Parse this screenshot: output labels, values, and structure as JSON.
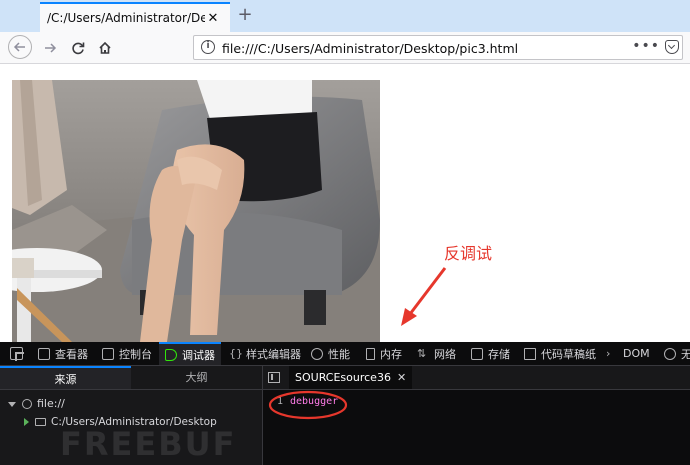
{
  "browser": {
    "tab": {
      "title": "/C:/Users/Administrator/Desktop",
      "close_glyph": "✕"
    },
    "new_tab_glyph": "+",
    "url": "file:///C:/Users/Administrator/Desktop/pic3.html",
    "more_glyph": "•••",
    "accent_color": "#0a84ff"
  },
  "annotation": {
    "label": "反调试",
    "color": "#e6372c"
  },
  "devtools": {
    "tabs": [
      {
        "label": "查看器",
        "icon": "inspector-icon"
      },
      {
        "label": "控制台",
        "icon": "console-icon"
      },
      {
        "label": "调试器",
        "icon": "debugger-icon",
        "active": true
      },
      {
        "label": "样式编辑器",
        "icon": "style-editor-icon"
      },
      {
        "label": "性能",
        "icon": "performance-icon"
      },
      {
        "label": "内存",
        "icon": "memory-icon"
      },
      {
        "label": "网络",
        "icon": "network-icon"
      },
      {
        "label": "存储",
        "icon": "storage-icon"
      },
      {
        "label": "代码草稿纸",
        "icon": "scratchpad-icon"
      },
      {
        "label": "DOM",
        "icon": "dom-icon"
      },
      {
        "label": "无",
        "icon": "accessibility-icon"
      }
    ],
    "sources_panel": {
      "tab_sources": "来源",
      "tab_outline": "大纲",
      "tree_root": "file://",
      "tree_child": "C:/Users/Administrator/Desktop"
    },
    "editor": {
      "file_tab": "SOURCEsource36",
      "close_glyph": "✕",
      "line_number": "1",
      "code": "debugger",
      "code_color": "#ff7de9"
    }
  },
  "watermark": "FREEBUF"
}
